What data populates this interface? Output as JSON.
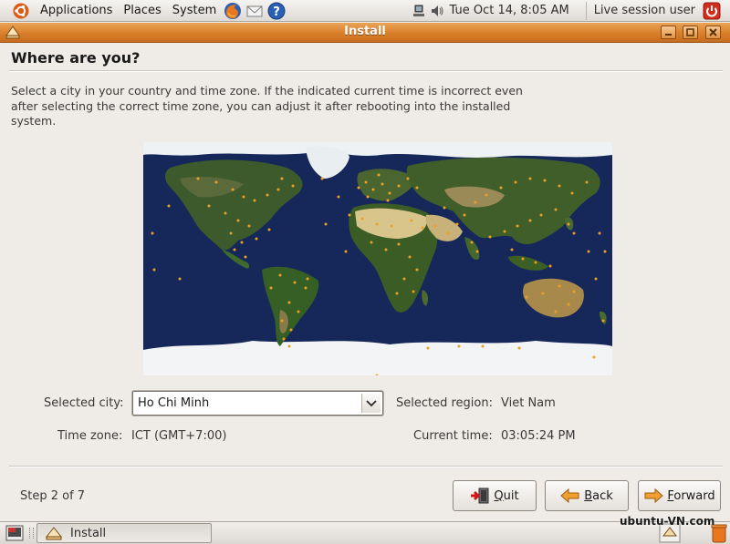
{
  "top_panel": {
    "menus": [
      "Applications",
      "Places",
      "System"
    ],
    "clock": "Tue Oct 14,  8:05 AM",
    "session_user": "Live session user"
  },
  "window": {
    "title": "Install"
  },
  "page": {
    "title": "Where are you?",
    "intro": "Select a city in your country and time zone. If the indicated current time is incorrect even after selecting the correct time zone, you can adjust it after rebooting into the installed system."
  },
  "form": {
    "city_label": "Selected city:",
    "city_value": "Ho Chi Minh",
    "region_label": "Selected region:",
    "region_value": "Viet Nam",
    "timezone_label": "Time zone:",
    "timezone_value": "ICT (GMT+7:00)",
    "current_time_label": "Current time:",
    "current_time_value": "03:05:24 PM"
  },
  "footer": {
    "step": "Step 2 of 7",
    "quit_mnemonic": "Q",
    "quit_rest": "uit",
    "back_mnemonic": "B",
    "back_rest": "ack",
    "forward_mnemonic": "F",
    "forward_rest": "orward"
  },
  "taskbar": {
    "task_label": "Install"
  },
  "watermark": "ubuntu-VN.com",
  "colors": {
    "title_bar": "#d97f2a",
    "ocean": "#16285a",
    "city_dot": "#f0a020"
  },
  "icons": [
    "ubuntu-logo-icon",
    "firefox-icon",
    "mail-icon",
    "help-icon",
    "network-icon",
    "volume-icon",
    "power-icon"
  ]
}
